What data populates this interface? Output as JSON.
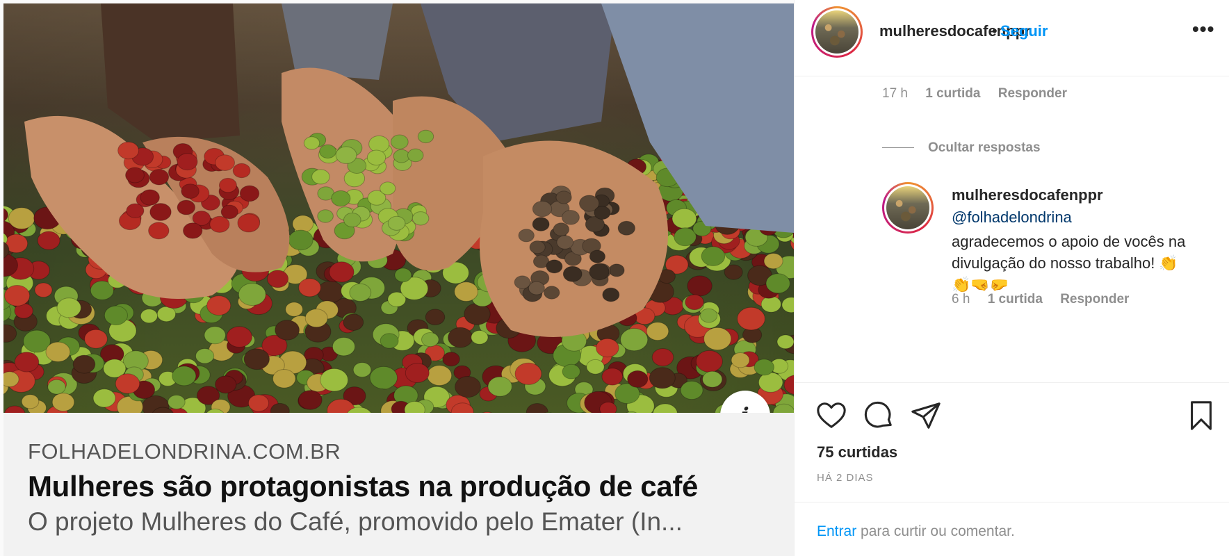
{
  "post": {
    "link_card": {
      "domain": "FOLHADELONDRINA.COM.BR",
      "title": "Mulheres são protagonistas na produção de café",
      "description": "O projeto Mulheres do Café, promovido pelo Emater (In..."
    },
    "info_icon": "info-icon"
  },
  "header": {
    "username": "mulheresdocafenppr",
    "separator": "•",
    "follow_label": "Seguir",
    "more_label": "•••"
  },
  "comments": {
    "parent_meta": {
      "time": "17 h",
      "likes": "1 curtida",
      "reply": "Responder"
    },
    "hide_replies_label": "Ocultar respostas",
    "reply": {
      "username": "mulheresdocafenppr",
      "mention": "@folhadelondrina",
      "text": "agradecemos o apoio de vocês na divulgação do nosso trabalho! 👏👏🤜🤛",
      "meta": {
        "time": "6 h",
        "likes": "1 curtida",
        "reply": "Responder"
      }
    }
  },
  "actions": {
    "icons": [
      "heart-icon",
      "comment-icon",
      "share-icon",
      "bookmark-icon"
    ],
    "likes_count": "75 curtidas",
    "date": "HÁ 2 DIAS"
  },
  "login_prompt": {
    "link": "Entrar",
    "text": " para curtir ou comentar."
  },
  "colors": {
    "accent_blue": "#0095f6",
    "mention_blue": "#00376b",
    "muted": "#8e8e8e",
    "text": "#262626"
  }
}
